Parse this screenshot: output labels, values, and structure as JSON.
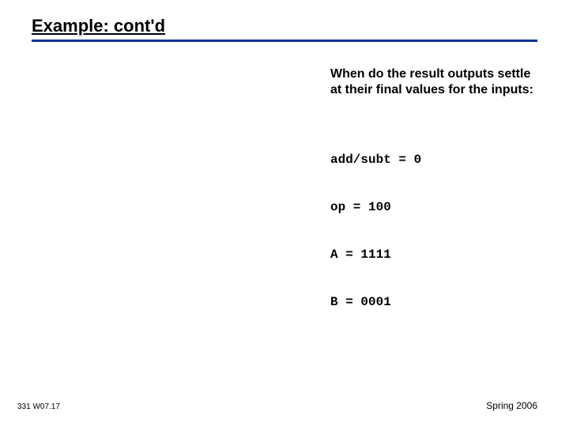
{
  "title": "Example: cont'd",
  "question": "When do the result outputs settle at their final values for the inputs:",
  "code": {
    "line1": "add/subt = 0",
    "line2": "op = 100",
    "line3": "A = 1111",
    "line4": "B = 0001"
  },
  "footer": {
    "left": "331 W07.17",
    "right": "Spring 2006"
  }
}
